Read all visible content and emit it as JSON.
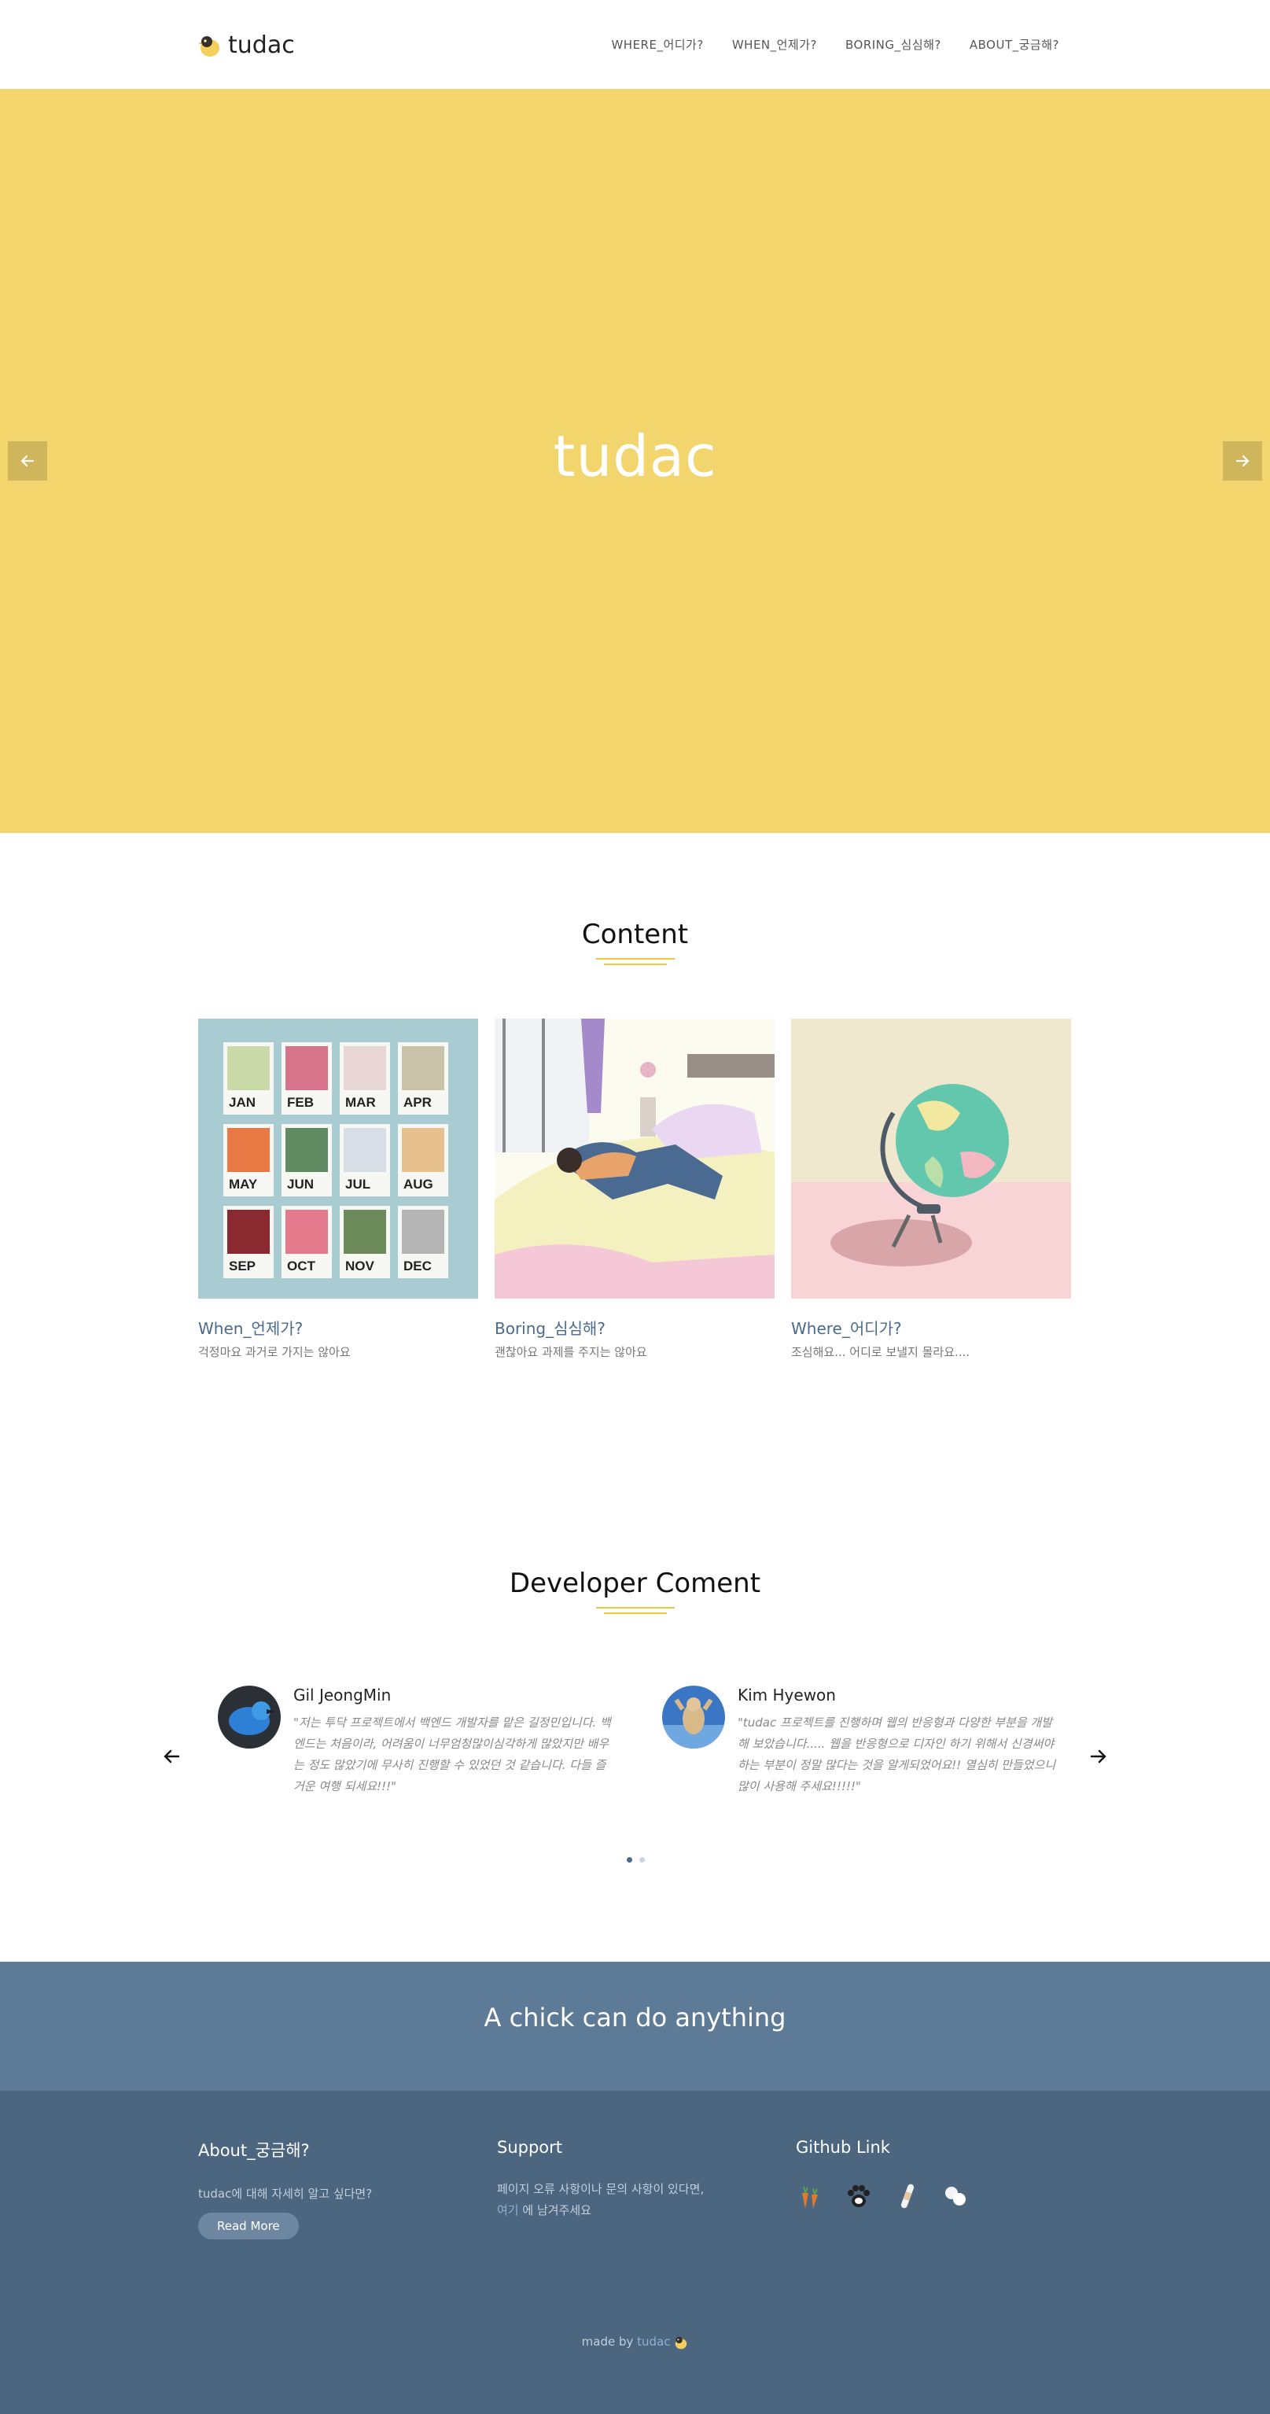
{
  "header": {
    "logo_text": "tudac",
    "nav": [
      "WHERE_어디가?",
      "WHEN_언제가?",
      "BORING_심심해?",
      "ABOUT_궁금해?"
    ]
  },
  "hero": {
    "title": "tudac"
  },
  "content": {
    "title": "Content",
    "cards": [
      {
        "title": "When_언제가?",
        "desc": "걱정마요 과거로 가지는 않아요",
        "months": [
          "JAN",
          "FEB",
          "MAR",
          "APR",
          "MAY",
          "JUN",
          "JUL",
          "AUG",
          "SEP",
          "OCT",
          "NOV",
          "DEC"
        ]
      },
      {
        "title": "Boring_심심해?",
        "desc": "괜찮아요 과제를 주지는 않아요"
      },
      {
        "title": "Where_어디가?",
        "desc": "조심해요... 어디로 보낼지 몰라요...."
      }
    ]
  },
  "developers": {
    "title": "Developer Coment",
    "items": [
      {
        "name": "Gil JeongMin",
        "quote": "\"저는 투닥 프로젝트에서 백엔드 개발자를 맡은 길정민입니다. 백엔드는 처음이라, 어려움이 너무엄청많이심각하게 많았지만 배우는 정도 많았기에 무사히 진행할 수 있었던 것 같습니다. 다들 즐거운 여행 되세요!!!\""
      },
      {
        "name": "Kim Hyewon",
        "quote": "\"tudac 프로젝트를 진행하며 웹의 반응형과 다양한 부분을 개발해 보았습니다..... 웹을 반응형으로 디자인 하기 위해서 신경써야하는 부분이 정말 많다는 것을 알게되었어요!! 열심히 만들었으니 많이 사용해 주세요!!!!!\""
      }
    ]
  },
  "banner": {
    "text": "A chick can do anything"
  },
  "footer": {
    "about": {
      "title": "About_궁금해?",
      "text_hl": "tudac",
      "text_rest": "에 대해 자세히 알고 싶다면?",
      "button": "Read More"
    },
    "support": {
      "title": "Support",
      "line1": "페이지 오류 사항이나 문의 사항이 있다면,",
      "link": "여기",
      "line2_rest": " 에 남겨주세요"
    },
    "github": {
      "title": "Github Link",
      "icons": [
        "carrot-icon",
        "paw-icon",
        "bandage-icon",
        "cotton-icon"
      ]
    },
    "made_by_prefix": "made by ",
    "made_by_name": "tudac"
  },
  "colors": {
    "hero_bg": "#f2d66d",
    "accent_yellow": "#f0c83c",
    "banner_bg": "#5d7a96",
    "footer_bg": "#4c6680",
    "link_blue": "#4a6a8e"
  }
}
